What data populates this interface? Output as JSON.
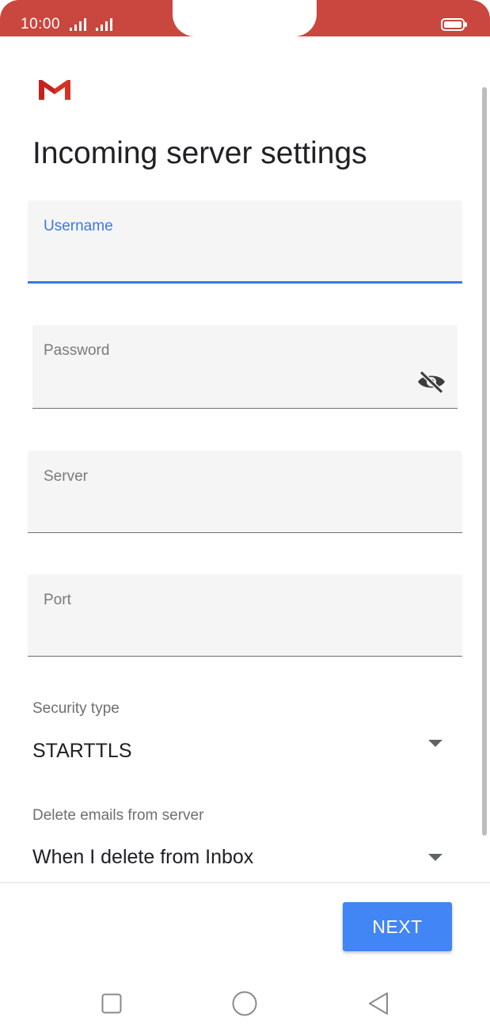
{
  "status_bar": {
    "time": "10:00",
    "icons": [
      "signal-icon",
      "signal-icon",
      "battery-icon"
    ],
    "color": "#c9473e"
  },
  "app": {
    "logo": "gmail-icon"
  },
  "page": {
    "title": "Incoming server settings"
  },
  "fields": {
    "username": {
      "label": "Username",
      "value": ""
    },
    "password": {
      "label": "Password",
      "value": "",
      "toggle_icon": "eye-off-icon"
    },
    "server": {
      "label": "Server",
      "value": ""
    },
    "port": {
      "label": "Port",
      "value": ""
    }
  },
  "security_type": {
    "label": "Security type",
    "value": "STARTTLS"
  },
  "delete_emails": {
    "label": "Delete emails from server",
    "value": "When I delete from Inbox"
  },
  "actions": {
    "next_label": "NEXT",
    "accent": "#4285f4"
  },
  "nav_bar": {
    "icons": [
      "recents-icon",
      "home-icon",
      "back-icon"
    ]
  }
}
